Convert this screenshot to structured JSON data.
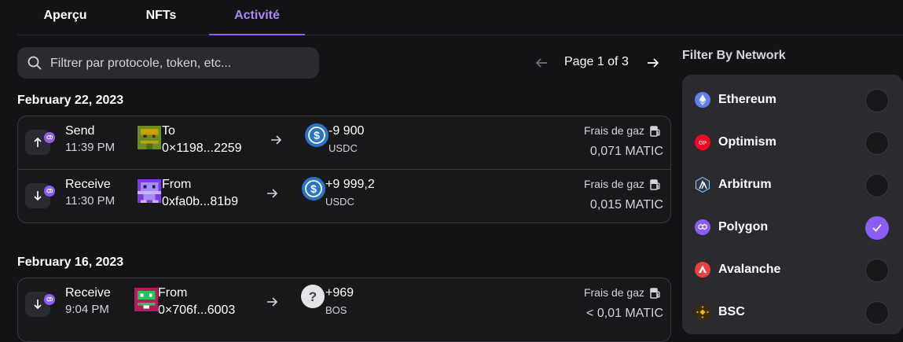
{
  "tabs": [
    {
      "label": "Aperçu",
      "active": false
    },
    {
      "label": "NFTs",
      "active": false
    },
    {
      "label": "Activité",
      "active": true
    }
  ],
  "search": {
    "placeholder": "Filtrer par protocole, token, etc...",
    "icon": "search-icon"
  },
  "pagination": {
    "text": "Page 1 of 3",
    "prev_icon": "arrow-left-icon",
    "next_icon": "arrow-right-icon"
  },
  "groups": [
    {
      "date": "February 22, 2023",
      "transactions": [
        {
          "type": "Send",
          "time": "11:39 PM",
          "direction": "up",
          "party_label": "To",
          "address": "0×1198...2259",
          "amount": "-9 900",
          "symbol": "USDC",
          "token_icon": "usdc-icon",
          "gas_label": "Frais de gaz",
          "gas_value": "0,071 MATIC"
        },
        {
          "type": "Receive",
          "time": "11:30 PM",
          "direction": "down",
          "party_label": "From",
          "address": "0xfa0b...81b9",
          "amount": "+9 999,2",
          "symbol": "USDC",
          "token_icon": "usdc-icon",
          "gas_label": "Frais de gaz",
          "gas_value": "0,015 MATIC"
        }
      ]
    },
    {
      "date": "February 16, 2023",
      "transactions": [
        {
          "type": "Receive",
          "time": "9:04 PM",
          "direction": "down",
          "party_label": "From",
          "address": "0×706f...6003",
          "amount": "+969",
          "symbol": "BOS",
          "token_icon": "unknown-token-icon",
          "gas_label": "Frais de gaz",
          "gas_value": "< 0,01 MATIC"
        }
      ]
    }
  ],
  "filter": {
    "title": "Filter By Network",
    "networks": [
      {
        "label": "Ethereum",
        "checked": false,
        "icon": "ethereum-icon"
      },
      {
        "label": "Optimism",
        "checked": false,
        "icon": "optimism-icon",
        "icon_text": "OP"
      },
      {
        "label": "Arbitrum",
        "checked": false,
        "icon": "arbitrum-icon"
      },
      {
        "label": "Polygon",
        "checked": true,
        "icon": "polygon-icon"
      },
      {
        "label": "Avalanche",
        "checked": false,
        "icon": "avalanche-icon"
      },
      {
        "label": "BSC",
        "checked": false,
        "icon": "bsc-icon"
      }
    ]
  },
  "colors": {
    "background": "#131316",
    "accent": "#8b5cf6",
    "panel": "#2a2a2f"
  }
}
